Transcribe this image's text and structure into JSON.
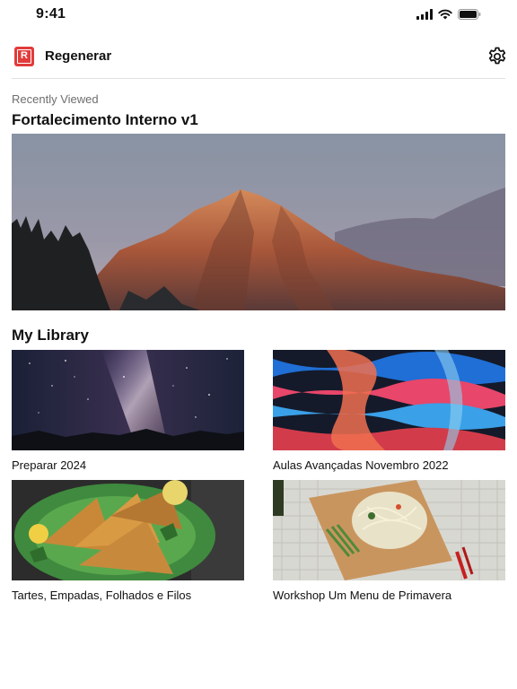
{
  "status_bar": {
    "time": "9:41",
    "icons": [
      "cellular-signal-icon",
      "wifi-icon",
      "battery-icon"
    ]
  },
  "header": {
    "logo_letter": "R",
    "app_name": "Regenerar",
    "settings_icon": "gear-icon",
    "brand_color": "#e23b3b"
  },
  "recently_viewed": {
    "label": "Recently Viewed",
    "title": "Fortalecimento Interno v1",
    "image": "mountain-sunset-photo"
  },
  "library": {
    "heading": "My Library",
    "items": [
      {
        "title": "Preparar 2024",
        "image": "milky-way-night-sky-photo"
      },
      {
        "title": "Aulas Avançadas Novembro 2022",
        "image": "abstract-fluid-paint-photo"
      },
      {
        "title": "Tartes, Empadas, Folhados e Filos",
        "image": "samosas-on-plate-photo"
      },
      {
        "title": "Workshop Um Menu de Primavera",
        "image": "noodle-salad-on-board-photo"
      }
    ]
  }
}
